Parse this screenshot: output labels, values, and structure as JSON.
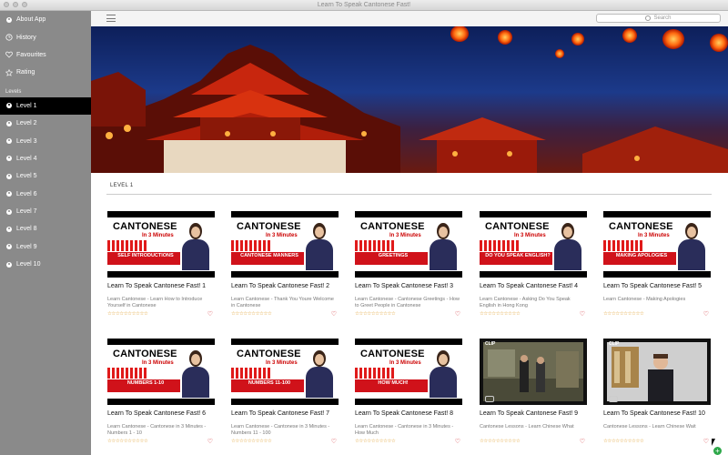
{
  "window": {
    "title": "Learn To Speak Cantonese Fast!"
  },
  "sidebar": {
    "top_items": [
      {
        "label": "About App",
        "icon": "info-icon"
      },
      {
        "label": "History",
        "icon": "clock-icon"
      },
      {
        "label": "Favourites",
        "icon": "heart-icon"
      },
      {
        "label": "Rating",
        "icon": "star-icon"
      }
    ],
    "section_label": "Levels",
    "levels": [
      "Level 1",
      "Level 2",
      "Level 3",
      "Level 4",
      "Level 5",
      "Level 6",
      "Level 7",
      "Level 8",
      "Level 9",
      "Level 10"
    ],
    "active_level": "Level 1"
  },
  "toolbar": {
    "search_placeholder": "Search"
  },
  "content": {
    "heading": "LEVEL 1",
    "cards": [
      {
        "title": "Learn To Speak Cantonese Fast! 1",
        "desc": "Learn Cantonese - Learn How to Introduce Yourself in Cantonese",
        "thumb": "canto",
        "brand": "CANTONESE",
        "sub": "In 3 Minutes",
        "banner": "SELF INTRODUCTIONS"
      },
      {
        "title": "Learn To Speak Cantonese Fast! 2",
        "desc": "Learn Cantonese - Thank You  Youre Welcome in Cantonese",
        "thumb": "canto",
        "brand": "CANTONESE",
        "sub": "In 3 Minutes",
        "banner": "CANTONESE MANNERS"
      },
      {
        "title": "Learn To Speak Cantonese Fast! 3",
        "desc": "Learn Cantonese - Cantonese Greetings - How to Greet People in Cantonese",
        "thumb": "canto",
        "brand": "CANTONESE",
        "sub": "In 3 Minutes",
        "banner": "GREETINGS"
      },
      {
        "title": "Learn To Speak Cantonese Fast! 4",
        "desc": "Learn Cantonese - Asking Do You Speak English in Hong Kong",
        "thumb": "canto",
        "brand": "CANTONESE",
        "sub": "In 3 Minutes",
        "banner": "DO YOU SPEAK ENGLISH?"
      },
      {
        "title": "Learn To Speak Cantonese Fast! 5",
        "desc": "Learn Cantonese - Making Apologies",
        "thumb": "canto",
        "brand": "CANTONESE",
        "sub": "In 3 Minutes",
        "banner": "MAKING APOLOGIES"
      },
      {
        "title": "Learn To Speak Cantonese Fast! 6",
        "desc": "Learn Cantonese - Cantonese in 3 Minutes - Numbers 1 - 10",
        "thumb": "canto",
        "brand": "CANTONESE",
        "sub": "In 3 Minutes",
        "banner": "NUMBERS 1-10"
      },
      {
        "title": "Learn To Speak Cantonese Fast! 7",
        "desc": "Learn Cantonese - Cantonese in 3 Minutes - Numbers 11 - 100",
        "thumb": "canto",
        "brand": "CANTONESE",
        "sub": "In 3 Minutes",
        "banner": "NUMBERS 11-100"
      },
      {
        "title": "Learn To Speak Cantonese Fast! 8",
        "desc": "Learn Cantonese - Cantonese in 3 Minutes - How Much",
        "thumb": "canto",
        "brand": "CANTONESE",
        "sub": "In 3 Minutes",
        "banner": "HOW MUCH!"
      },
      {
        "title": "Learn To Speak Cantonese Fast! 9",
        "desc": "Cantonese Lessons - Learn Chinese  What",
        "thumb": "video",
        "scene": "outdoor"
      },
      {
        "title": "Learn To Speak Cantonese Fast! 10",
        "desc": "Cantonese Lessons - Learn Chinese  Wait",
        "thumb": "video",
        "scene": "studio"
      }
    ]
  },
  "colors": {
    "sidebar": "#8a8a8a",
    "active": "#000000",
    "accent_red": "#d0121a",
    "heart": "#d0242a",
    "stars": "#e0a030",
    "add_button": "#2ea84a"
  }
}
